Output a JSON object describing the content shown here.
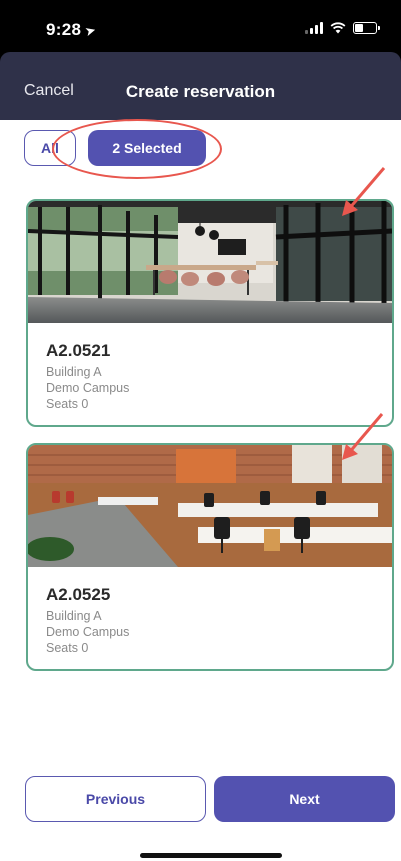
{
  "status_bar": {
    "time": "9:28",
    "location_icon": "location-arrow-icon",
    "signal_icon": "cellular-signal-icon",
    "wifi_icon": "wifi-icon",
    "battery_icon": "battery-icon",
    "battery_level": 0.4
  },
  "header": {
    "cancel_label": "Cancel",
    "title": "Create reservation"
  },
  "filters": {
    "all_label": "All",
    "selected_label": "2 Selected",
    "active": "selected"
  },
  "rooms": [
    {
      "name": "A2.0521",
      "building": "Building A",
      "campus": "Demo Campus",
      "seats": "Seats 0",
      "image": "open-office-lounge-photo"
    },
    {
      "name": "A2.0525",
      "building": "Building A",
      "campus": "Demo Campus",
      "seats": "Seats 0",
      "image": "open-office-desks-photo"
    }
  ],
  "actions": {
    "previous_label": "Previous",
    "next_label": "Next"
  },
  "colors": {
    "accent": "#5352b0",
    "header_bg": "#2f3149",
    "card_border": "#5fa88c",
    "annotation": "#e8574e"
  }
}
